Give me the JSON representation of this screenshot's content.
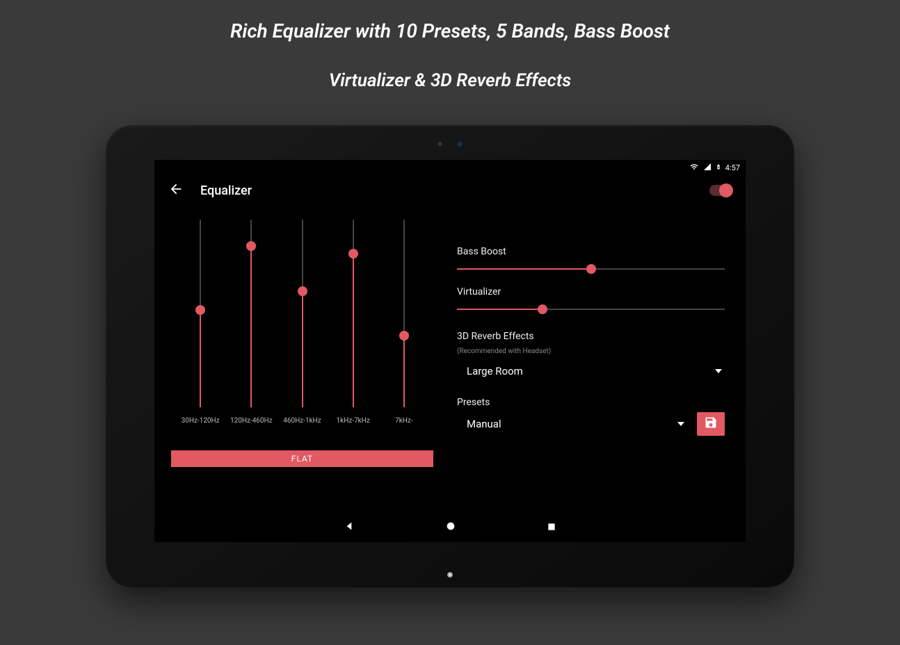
{
  "promo": {
    "line1": "Rich Equalizer with 10 Presets, 5 Bands, Bass Boost",
    "line2": "Virtualizer & 3D Reverb Effects"
  },
  "status": {
    "time": "4:57"
  },
  "appbar": {
    "title": "Equalizer",
    "toggle_on": true
  },
  "eq": {
    "bands": [
      {
        "label": "30Hz-120Hz",
        "value": 52
      },
      {
        "label": "120Hz-460Hz",
        "value": 86
      },
      {
        "label": "460Hz-1kHz",
        "value": 62
      },
      {
        "label": "1kHz-7kHz",
        "value": 82
      },
      {
        "label": "7kHz-",
        "value": 38
      }
    ],
    "flat_label": "FLAT"
  },
  "controls": {
    "bass_label": "Bass Boost",
    "bass_value": 50,
    "virt_label": "Virtualizer",
    "virt_value": 32,
    "reverb_title": "3D Reverb Effects",
    "reverb_sub": "(Recommended with Headset)",
    "reverb_value": "Large Room",
    "presets_title": "Presets",
    "presets_value": "Manual"
  },
  "colors": {
    "accent": "#e15a63"
  }
}
